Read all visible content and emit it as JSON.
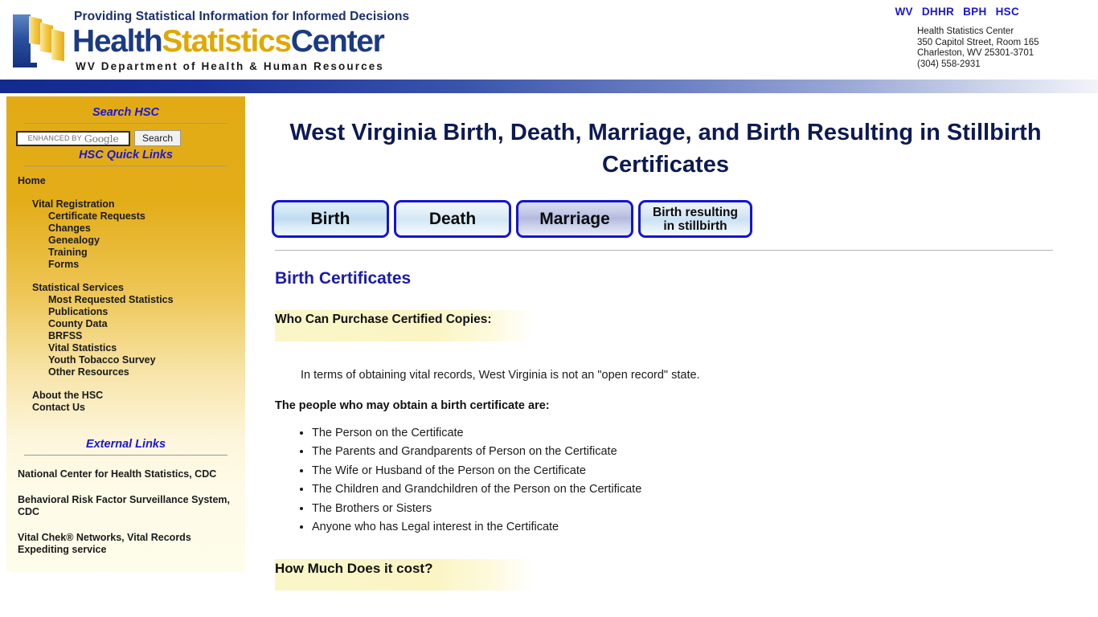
{
  "header": {
    "tagline": "Providing Statistical Information for Informed Decisions",
    "wordmark": {
      "part1": "Health",
      "part2": "Statistics",
      "part3": "Center"
    },
    "department": "WV Department of Health & Human Resources",
    "agency_links": [
      "WV",
      "DHHR",
      "BPH",
      "HSC"
    ],
    "address": {
      "line1": "Health Statistics Center",
      "line2": "350 Capitol Street, Room 165",
      "line3": "Charleston, WV 25301-3701",
      "line4": "(304) 558-2931"
    }
  },
  "sidebar": {
    "search_heading": "Search HSC",
    "search_box": {
      "enhanced_by": "ENHANCED BY",
      "brand": "Google"
    },
    "search_button": "Search",
    "quicklinks_heading": "HSC Quick Links",
    "nav": [
      {
        "label": "Home",
        "level": 0
      },
      {
        "label": "Vital Registration",
        "level": 1
      },
      {
        "label": "Certificate Requests",
        "level": 2
      },
      {
        "label": "Changes",
        "level": 2
      },
      {
        "label": "Genealogy",
        "level": 2
      },
      {
        "label": "Training",
        "level": 2
      },
      {
        "label": "Forms",
        "level": 2
      },
      {
        "label": "Statistical Services",
        "level": 1
      },
      {
        "label": "Most Requested Statistics",
        "level": 2
      },
      {
        "label": "Publications",
        "level": 2
      },
      {
        "label": "County Data",
        "level": 2
      },
      {
        "label": "BRFSS",
        "level": 2
      },
      {
        "label": "Vital Statistics",
        "level": 2
      },
      {
        "label": "Youth Tobacco Survey",
        "level": 2
      },
      {
        "label": "Other Resources",
        "level": 2
      },
      {
        "label": "About the HSC",
        "level": 1
      },
      {
        "label": "Contact Us",
        "level": 1
      }
    ],
    "external_heading": "External Links",
    "external_links": [
      "National Center for Health Statistics, CDC",
      "Behavioral Risk Factor Surveillance System, CDC",
      "Vital Chek® Networks, Vital Records Expediting service"
    ]
  },
  "main": {
    "page_title": "West Virginia Birth, Death, Marriage, and Birth Resulting in Stillbirth Certificates",
    "tabs": [
      {
        "label": "Birth"
      },
      {
        "label": "Death"
      },
      {
        "label": "Marriage"
      },
      {
        "label_line1": "Birth resulting",
        "label_line2": "in stillbirth"
      }
    ],
    "section_heading": "Birth Certificates",
    "who_heading": "Who Can Purchase Certified Copies:",
    "intro_paragraph": "In terms of obtaining vital records, West Virginia is not an \"open record\" state.",
    "people_intro": "The people who may obtain a birth certificate are:",
    "people_list": [
      "The Person on the Certificate",
      "The Parents and Grandparents of Person on the Certificate",
      "The Wife or Husband of the Person on the Certificate",
      "The Children and Grandchildren of the Person on the Certificate",
      "The Brothers or Sisters",
      "Anyone who has Legal interest in the Certificate"
    ],
    "cost_heading": "How Much Does it cost?"
  },
  "colors": {
    "brand_blue": "#1b3a82",
    "brand_gold": "#e0a800",
    "link_blue": "#1a16d8",
    "title_navy": "#0d1a52",
    "sidebar_gold": "#e2ab16",
    "highlight_yellow": "#fbf6c8",
    "tab_border": "#1414d2"
  }
}
